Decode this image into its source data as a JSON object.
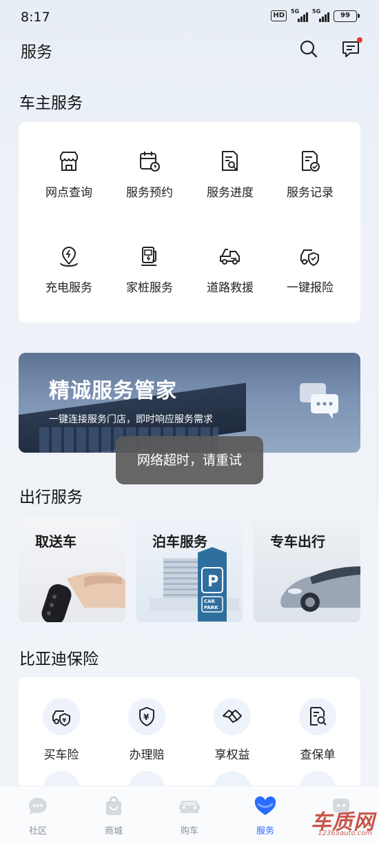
{
  "status": {
    "time": "8:17",
    "hd": "HD",
    "signal1": "5G",
    "signal2": "5G",
    "battery": "99"
  },
  "header": {
    "title": "服务"
  },
  "owner_services": {
    "title": "车主服务",
    "items": [
      {
        "label": "网点查询",
        "icon": "store-icon"
      },
      {
        "label": "服务预约",
        "icon": "calendar-clock-icon"
      },
      {
        "label": "服务进度",
        "icon": "document-search-icon"
      },
      {
        "label": "服务记录",
        "icon": "document-check-icon"
      },
      {
        "label": "充电服务",
        "icon": "charging-location-icon"
      },
      {
        "label": "家桩服务",
        "icon": "home-charger-icon"
      },
      {
        "label": "道路救援",
        "icon": "tow-truck-icon"
      },
      {
        "label": "一键报险",
        "icon": "car-shield-icon"
      }
    ]
  },
  "banner": {
    "title": "精诚服务管家",
    "subtitle": "一键连接服务门店，即时响应服务需求"
  },
  "toast": {
    "message": "网络超时，请重试"
  },
  "travel_services": {
    "title": "出行服务",
    "items": [
      {
        "label": "取送车"
      },
      {
        "label": "泊车服务"
      },
      {
        "label": "专车出行"
      }
    ]
  },
  "insurance": {
    "title": "比亚迪保险",
    "items": [
      {
        "label": "买车险",
        "icon": "car-yuan-icon"
      },
      {
        "label": "办理赔",
        "icon": "shield-yuan-icon"
      },
      {
        "label": "享权益",
        "icon": "handshake-icon"
      },
      {
        "label": "查保单",
        "icon": "policy-search-icon"
      }
    ]
  },
  "tabbar": {
    "items": [
      {
        "label": "社区"
      },
      {
        "label": "商城"
      },
      {
        "label": "购车"
      },
      {
        "label": "服务"
      },
      {
        "label": ""
      }
    ],
    "active_index": 3,
    "active_color": "#2b6bff"
  },
  "watermark": {
    "text": "车质网",
    "sub": "12365auto.com"
  }
}
